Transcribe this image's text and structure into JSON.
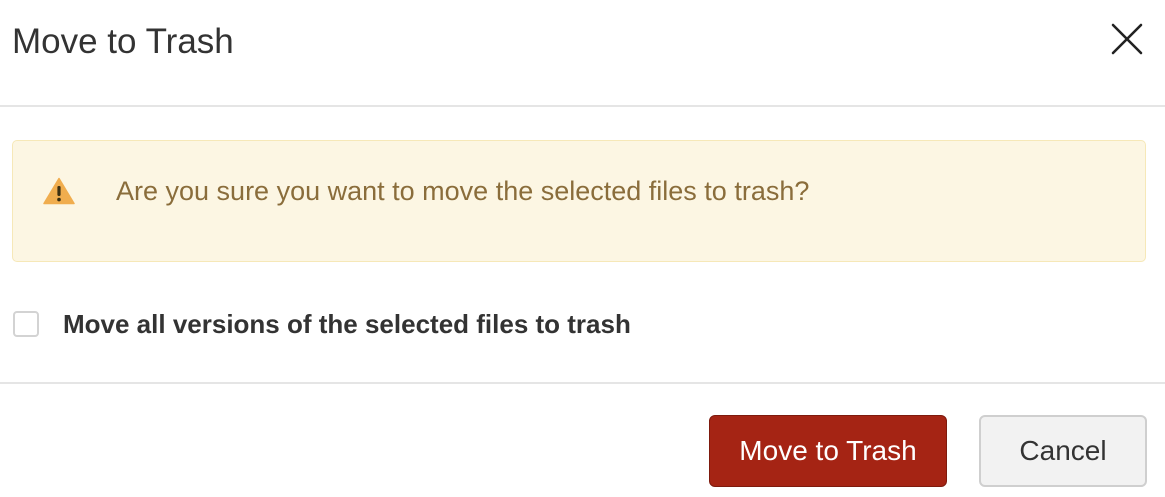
{
  "dialog": {
    "title": "Move to Trash",
    "close_icon": "close-icon"
  },
  "warning": {
    "icon": "warning-triangle-icon",
    "message": "Are you sure you want to move the selected files to trash?",
    "colors": {
      "background": "#fcf6e3",
      "border": "#f6e8b8",
      "text": "#8a6d3b",
      "icon": "#f0ad4e"
    }
  },
  "option": {
    "label": "Move all versions of the selected files to trash",
    "checked": false
  },
  "footer": {
    "confirm_label": "Move to Trash",
    "cancel_label": "Cancel",
    "colors": {
      "confirm_background": "#a52414",
      "cancel_background": "#f2f2f2"
    }
  }
}
